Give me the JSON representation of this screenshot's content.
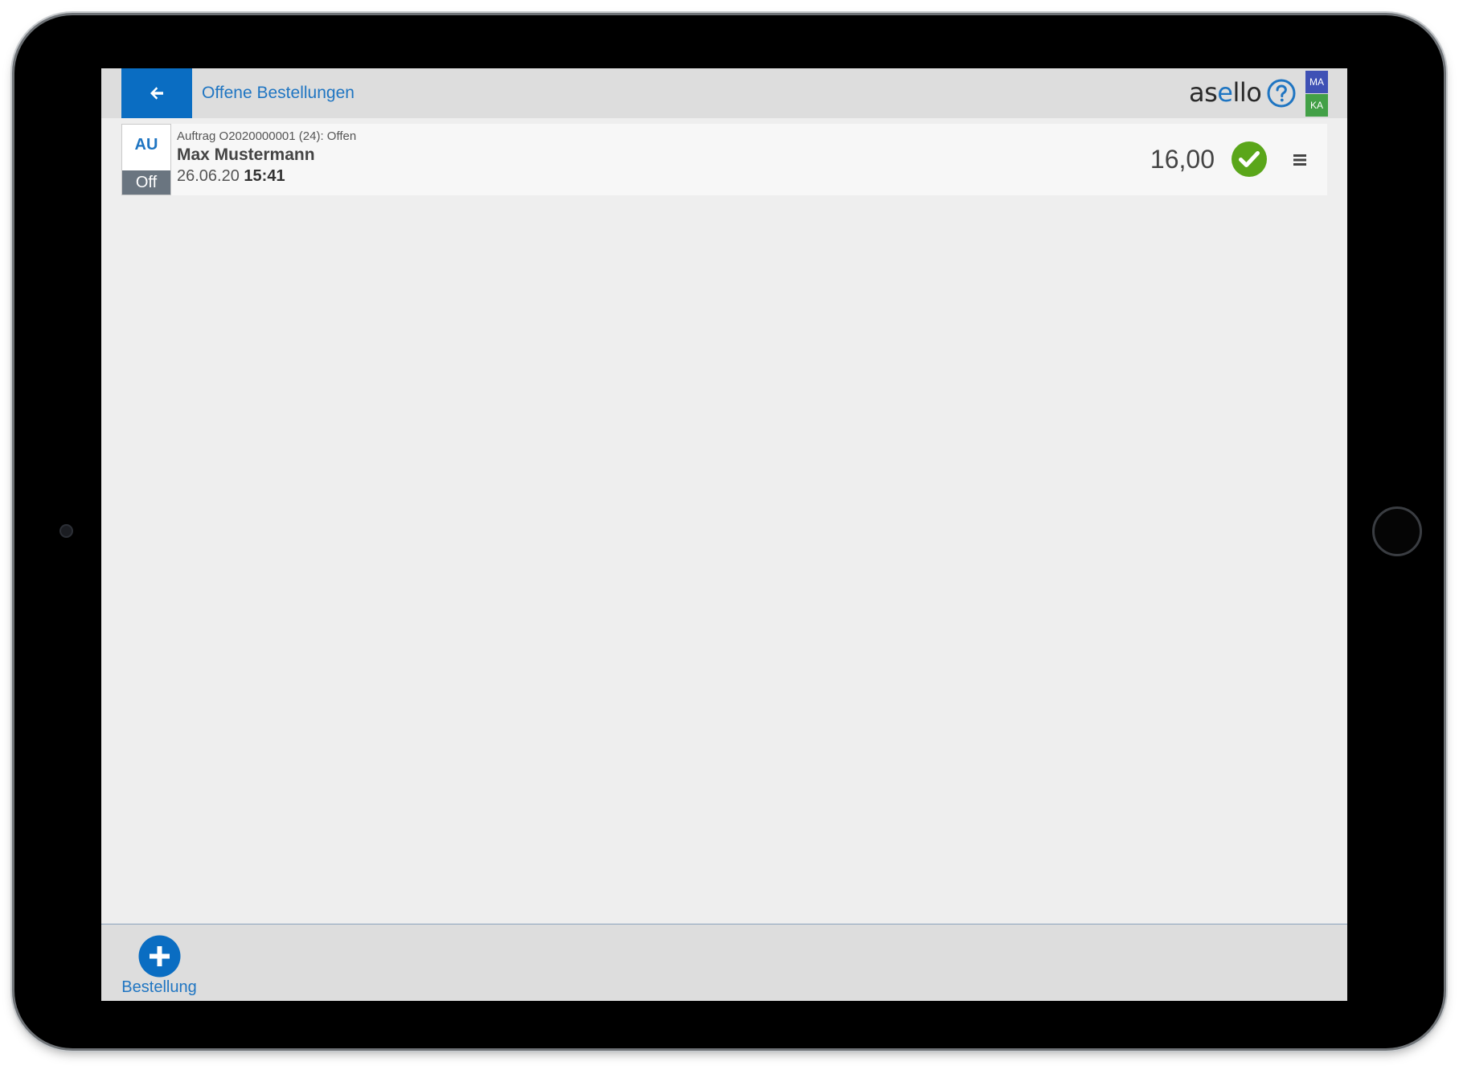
{
  "header": {
    "back_icon": "arrow-left-icon",
    "title": "Offene Bestellungen",
    "logo_text": "asello",
    "help_icon": "question-circle-icon",
    "badges": [
      {
        "label": "MA",
        "color": "#3f51b5"
      },
      {
        "label": "KA",
        "color": "#43a047"
      }
    ]
  },
  "orders": [
    {
      "type_code": "AU",
      "status_short": "Off",
      "reference": "Auftrag O2020000001 (24): Offen",
      "customer": "Max Mustermann",
      "date": "26.06.20",
      "time": "15:41",
      "amount": "16,00",
      "status_icon": "check-circle-icon",
      "menu_icon": "hamburger-menu-icon"
    }
  ],
  "footer": {
    "new_order_label": "Bestellung",
    "new_order_icon": "plus-circle-icon"
  },
  "colors": {
    "accent": "#0a6dc2",
    "success": "#5aa61a",
    "status_tile": "#6a7580"
  }
}
